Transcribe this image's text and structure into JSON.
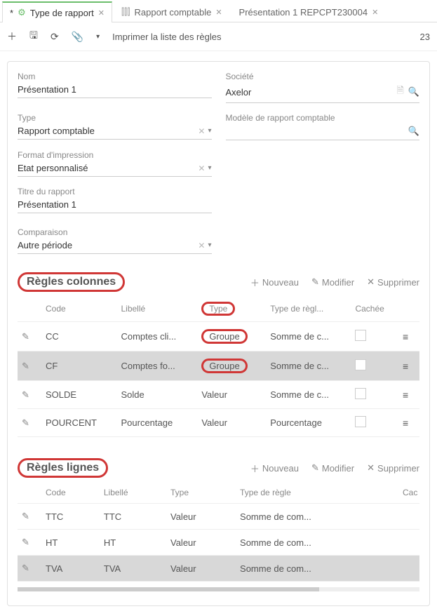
{
  "tabs": [
    {
      "label": "Type de rapport",
      "modified": "*",
      "icon": "gear",
      "active": true
    },
    {
      "label": "Rapport comptable",
      "icon": "chart",
      "active": false
    },
    {
      "label": "Présentation 1 REPCPT230004",
      "active": false
    }
  ],
  "toolbar": {
    "print_label": "Imprimer la liste des règles",
    "counter": "23"
  },
  "fields": {
    "nom": {
      "label": "Nom",
      "value": "Présentation 1"
    },
    "societe": {
      "label": "Société",
      "value": "Axelor"
    },
    "type": {
      "label": "Type",
      "value": "Rapport comptable"
    },
    "modele": {
      "label": "Modèle de rapport comptable",
      "value": ""
    },
    "format": {
      "label": "Format d'impression",
      "value": "Etat personnalisé"
    },
    "titre": {
      "label": "Titre du rapport",
      "value": "Présentation 1"
    },
    "comparaison": {
      "label": "Comparaison",
      "value": "Autre période"
    }
  },
  "sections": {
    "colonnes": {
      "title": "Règles colonnes"
    },
    "lignes": {
      "title": "Règles lignes"
    }
  },
  "actions": {
    "nouveau": "Nouveau",
    "modifier": "Modifier",
    "supprimer": "Supprimer"
  },
  "col_headers": {
    "code": "Code",
    "libelle": "Libellé",
    "type": "Type",
    "type_regle": "Type de règl...",
    "cachee": "Cachée"
  },
  "col_rows": [
    {
      "code": "CC",
      "libelle": "Comptes cli...",
      "type": "Groupe",
      "type_regle": "Somme de c..."
    },
    {
      "code": "CF",
      "libelle": "Comptes fo...",
      "type": "Groupe",
      "type_regle": "Somme de c...",
      "selected": true
    },
    {
      "code": "SOLDE",
      "libelle": "Solde",
      "type": "Valeur",
      "type_regle": "Somme de c..."
    },
    {
      "code": "POURCENT",
      "libelle": "Pourcentage",
      "type": "Valeur",
      "type_regle": "Pourcentage"
    }
  ],
  "lig_headers": {
    "code": "Code",
    "libelle": "Libellé",
    "type": "Type",
    "type_regle": "Type de règle",
    "cachee": "Cac"
  },
  "lig_rows": [
    {
      "code": "TTC",
      "libelle": "TTC",
      "type": "Valeur",
      "type_regle": "Somme de com..."
    },
    {
      "code": "HT",
      "libelle": "HT",
      "type": "Valeur",
      "type_regle": "Somme de com..."
    },
    {
      "code": "TVA",
      "libelle": "TVA",
      "type": "Valeur",
      "type_regle": "Somme de com...",
      "selected": true
    }
  ]
}
